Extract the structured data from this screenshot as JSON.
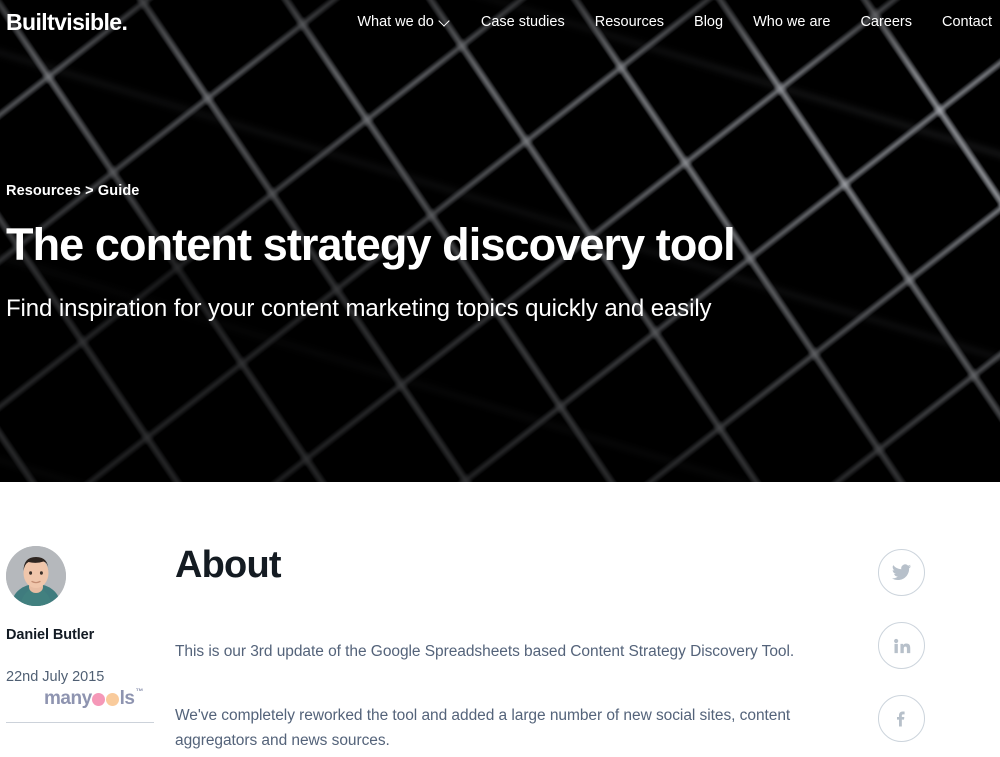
{
  "site": {
    "brand": "Builtvisible."
  },
  "nav": {
    "items": [
      {
        "label": "What we do",
        "icon": "chevron-down-icon",
        "has_dropdown": true
      },
      {
        "label": "Case studies",
        "has_dropdown": false
      },
      {
        "label": "Resources",
        "has_dropdown": false
      },
      {
        "label": "Blog",
        "has_dropdown": false
      },
      {
        "label": "Who we are",
        "has_dropdown": false
      },
      {
        "label": "Careers",
        "has_dropdown": false
      },
      {
        "label": "Contact",
        "has_dropdown": false
      }
    ]
  },
  "hero": {
    "breadcrumb": "Resources > Guide",
    "title": "The content strategy discovery tool",
    "subtitle": "Find inspiration for your content marketing topics quickly and easily",
    "background": "dark honeycomb netting photograph",
    "background_color": "#070707",
    "text_color": "#ffffff"
  },
  "meta": {
    "avatar_alt": "Daniel Butler headshot",
    "author": "Daniel Butler",
    "date": "22nd July 2015",
    "watermark": {
      "prefix": "many",
      "suffix": "ls",
      "trademark": "™",
      "dot_colors": [
        "#f598b8",
        "#f9cb9c"
      ],
      "text_color": "#8e94b0"
    }
  },
  "article": {
    "heading": "About",
    "paragraphs": [
      "This is our 3rd update of the Google Spreadsheets based Content Strategy Discovery Tool.",
      "We've completely reworked the tool and added a large number of new social sites, content aggregators and news sources."
    ],
    "heading_color": "#141b22",
    "body_color": "#54637a"
  },
  "social": {
    "items": [
      {
        "name": "twitter",
        "label": "Twitter"
      },
      {
        "name": "linkedin",
        "label": "LinkedIn"
      },
      {
        "name": "facebook",
        "label": "Facebook"
      }
    ],
    "border_color": "#ccd4dc",
    "glyph_color": "#b7c0ca"
  }
}
